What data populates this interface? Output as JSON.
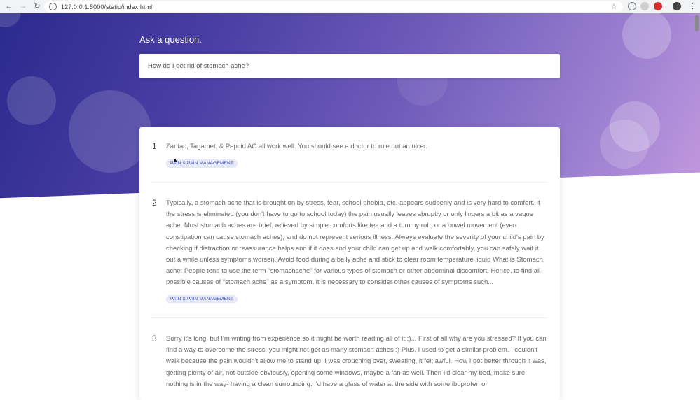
{
  "browser": {
    "url": "127.0.0.1:5000/static/index.html",
    "icons": [
      "back-icon",
      "forward-icon",
      "reload-icon",
      "info-icon",
      "star-icon",
      "extension-icon",
      "profile-icon",
      "menu-icon"
    ]
  },
  "hero": {
    "title": "Ask a question.",
    "search_value": "How do I get rid of stomach ache?",
    "colors": {
      "gradient_start": "#2a2a8e",
      "gradient_end": "#c79be0"
    }
  },
  "results": [
    {
      "rank": "1",
      "text": "Zantac, Tagamet, & Pepcid AC all work well. You should see a doctor to rule out an ulcer.",
      "tag": "PAIN & PAIN MANAGEMENT"
    },
    {
      "rank": "2",
      "text": "Typically, a stomach ache that is brought on by stress, fear, school phobia, etc. appears suddenly and is very hard to comfort. If the stress is eliminated (you don't have to go to school today) the pain usually leaves abruptly or only lingers a bit as a vague ache. Most stomach aches are brief, relieved by simple comforts like tea and a tummy rub, or a bowel movement (even constipation can cause stomach aches), and do not represent serious illness. Always evaluate the severity of your child's pain by checking if distraction or reassurance helps and if it does and your child can get up and walk comfortably, you can safely wait it out a while unless symptoms worsen. Avoid food during a belly ache and stick to clear room temperature liquid What is Stomach ache: People tend to use the term \"stomachache\" for various types of stomach or other abdominal discomfort. Hence, to find all possible causes of \"stomach ache\" as a symptom, it is necessary to consider other causes of symptoms such...",
      "tag": "PAIN & PAIN MANAGEMENT"
    },
    {
      "rank": "3",
      "text": "Sorry it's long, but I'm writing from experience so it might be worth reading all of it :)... First of all why are you stressed? If you can find a way to overcome the stress, you might not get as many stomach aches :) Plus, I used to get a similar problem. I couldn't walk because the pain wouldn't allow me to stand up, I was crouching over, sweating, it felt awful. How I got better through it was, getting plenty of air, not outside obviously, opening some windows, maybe a fan as well. Then I'd clear my bed, make sure nothing is in the way- having a clean surrounding. I'd have a glass of water at the side with some ibuprofen or",
      "tag": ""
    }
  ]
}
